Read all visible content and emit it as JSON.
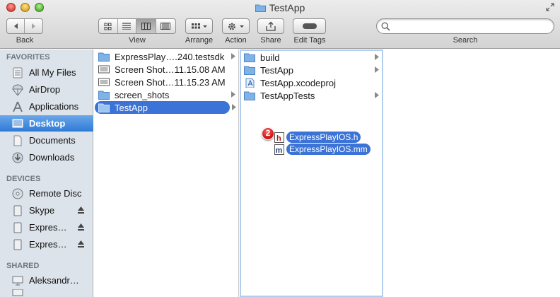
{
  "window": {
    "title": "TestApp"
  },
  "toolbar": {
    "back_label": "Back",
    "view_label": "View",
    "arrange_label": "Arrange",
    "action_label": "Action",
    "share_label": "Share",
    "edit_tags_label": "Edit Tags",
    "search_label": "Search",
    "search_value": "",
    "active_view": "columns"
  },
  "sidebar": {
    "favorites_header": "FAVORITES",
    "favorites": [
      {
        "label": "All My Files",
        "icon": "all-files-icon"
      },
      {
        "label": "AirDrop",
        "icon": "airdrop-icon"
      },
      {
        "label": "Applications",
        "icon": "applications-icon"
      },
      {
        "label": "Desktop",
        "icon": "desktop-icon",
        "selected": true
      },
      {
        "label": "Documents",
        "icon": "documents-icon"
      },
      {
        "label": "Downloads",
        "icon": "downloads-icon"
      }
    ],
    "devices_header": "DEVICES",
    "devices": [
      {
        "label": "Remote Disc",
        "icon": "disc-icon"
      },
      {
        "label": "Skype",
        "icon": "drive-icon",
        "eject": true
      },
      {
        "label": "Expres…",
        "icon": "drive-icon",
        "eject": true
      },
      {
        "label": "Expres…",
        "icon": "drive-icon",
        "eject": true
      }
    ],
    "shared_header": "SHARED",
    "shared": [
      {
        "label": "Aleksandr…",
        "icon": "computer-icon"
      }
    ]
  },
  "column1": [
    {
      "name": "ExpressPlay….240.testsdk",
      "icon": "folder-icon",
      "arrow": true
    },
    {
      "name": "Screen Shot…11.15.08 AM",
      "icon": "screenshot-icon",
      "arrow": false
    },
    {
      "name": "Screen Shot…11.15.23 AM",
      "icon": "screenshot-icon",
      "arrow": false
    },
    {
      "name": "screen_shots",
      "icon": "folder-icon",
      "arrow": true
    },
    {
      "name": "TestApp",
      "icon": "folder-icon",
      "arrow": true,
      "selected": true
    }
  ],
  "column2": [
    {
      "name": "build",
      "icon": "folder-icon",
      "arrow": true
    },
    {
      "name": "TestApp",
      "icon": "folder-icon",
      "arrow": true
    },
    {
      "name": "TestApp.xcodeproj",
      "icon": "xcodeproj-icon",
      "arrow": false
    },
    {
      "name": "TestAppTests",
      "icon": "folder-icon",
      "arrow": true
    }
  ],
  "drag": {
    "count": "2",
    "items": [
      {
        "name": "ExpressPlayIOS.h",
        "icon": "header-file-icon",
        "letter": "h"
      },
      {
        "name": "ExpressPlayIOS.mm",
        "icon": "objc-file-icon",
        "letter": "m"
      }
    ]
  },
  "colors": {
    "selection": "#3b74d6",
    "sidebar_bg": "#dde3ea",
    "folder_blue": "#7fb2e6",
    "badge_red": "#cc0b0b"
  }
}
